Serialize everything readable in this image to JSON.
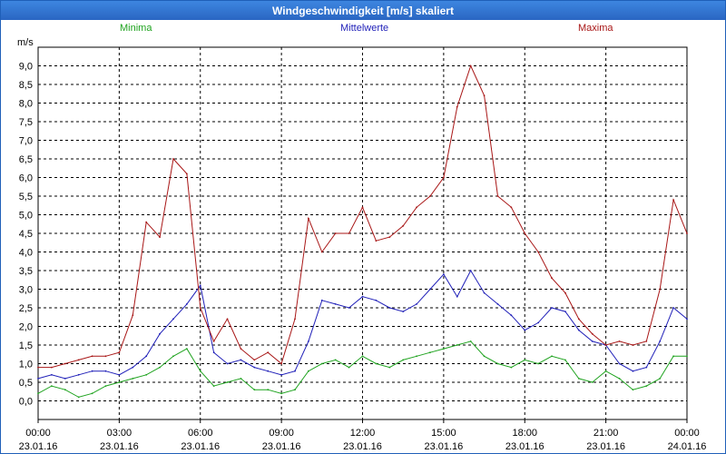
{
  "window": {
    "title": "Windgeschwindigkeit [m/s] skaliert"
  },
  "colors": {
    "minima": "#1fa31f",
    "mittelwerte": "#1f1fb8",
    "maxima": "#a81616",
    "title_bar": "#2f6fcf"
  },
  "chart_data": {
    "type": "line",
    "title": "Windgeschwindigkeit [m/s] skaliert",
    "ylabel": "m/s",
    "xlabel": "",
    "ylim": [
      -0.5,
      9.5
    ],
    "y_ticks": [
      "0,0",
      "0,5",
      "1,0",
      "1,5",
      "2,0",
      "2,5",
      "3,0",
      "3,5",
      "4,0",
      "4,5",
      "5,0",
      "5,5",
      "6,0",
      "6,5",
      "7,0",
      "7,5",
      "8,0",
      "8,5",
      "9,0"
    ],
    "x_ticks": [
      {
        "time": "00:00",
        "date": "23.01.16"
      },
      {
        "time": "03:00",
        "date": "23.01.16"
      },
      {
        "time": "06:00",
        "date": "23.01.16"
      },
      {
        "time": "09:00",
        "date": "23.01.16"
      },
      {
        "time": "12:00",
        "date": "23.01.16"
      },
      {
        "time": "15:00",
        "date": "23.01.16"
      },
      {
        "time": "18:00",
        "date": "23.01.16"
      },
      {
        "time": "21:00",
        "date": "23.01.16"
      },
      {
        "time": "00:00",
        "date": "24.01.16"
      }
    ],
    "xlim_hours": [
      0,
      24
    ],
    "grid": true,
    "legend_placement": "top",
    "series": [
      {
        "name": "Minima",
        "color": "#1fa31f",
        "x_hours": [
          0,
          0.5,
          1,
          1.5,
          2,
          2.5,
          3,
          3.5,
          4,
          4.5,
          5,
          5.5,
          6,
          6.5,
          7,
          7.5,
          8,
          8.5,
          9,
          9.5,
          10,
          10.5,
          11,
          11.5,
          12,
          12.5,
          13,
          13.5,
          14,
          14.5,
          15,
          15.5,
          16,
          16.5,
          17,
          17.5,
          18,
          18.5,
          19,
          19.5,
          20,
          20.5,
          21,
          21.5,
          22,
          22.5,
          23,
          23.5,
          24
        ],
        "values": [
          0.2,
          0.4,
          0.3,
          0.1,
          0.2,
          0.4,
          0.5,
          0.6,
          0.7,
          0.9,
          1.2,
          1.4,
          0.8,
          0.4,
          0.5,
          0.6,
          0.3,
          0.3,
          0.2,
          0.3,
          0.8,
          1.0,
          1.1,
          0.9,
          1.2,
          1.0,
          0.9,
          1.1,
          1.2,
          1.3,
          1.4,
          1.5,
          1.6,
          1.2,
          1.0,
          0.9,
          1.1,
          1.0,
          1.2,
          1.1,
          0.6,
          0.5,
          0.8,
          0.6,
          0.3,
          0.4,
          0.6,
          1.2,
          1.2
        ]
      },
      {
        "name": "Mittelwerte",
        "color": "#1f1fb8",
        "x_hours": [
          0,
          0.5,
          1,
          1.5,
          2,
          2.5,
          3,
          3.5,
          4,
          4.5,
          5,
          5.5,
          6,
          6.5,
          7,
          7.5,
          8,
          8.5,
          9,
          9.5,
          10,
          10.5,
          11,
          11.5,
          12,
          12.5,
          13,
          13.5,
          14,
          14.5,
          15,
          15.5,
          16,
          16.5,
          17,
          17.5,
          18,
          18.5,
          19,
          19.5,
          20,
          20.5,
          21,
          21.5,
          22,
          22.5,
          23,
          23.5,
          24
        ],
        "values": [
          0.6,
          0.7,
          0.6,
          0.7,
          0.8,
          0.8,
          0.7,
          0.9,
          1.2,
          1.8,
          2.2,
          2.6,
          3.1,
          1.3,
          1.0,
          1.1,
          0.9,
          0.8,
          0.7,
          0.8,
          1.6,
          2.7,
          2.6,
          2.5,
          2.8,
          2.7,
          2.5,
          2.4,
          2.6,
          3.0,
          3.4,
          2.8,
          3.5,
          2.9,
          2.6,
          2.3,
          1.9,
          2.1,
          2.5,
          2.4,
          1.9,
          1.6,
          1.5,
          1.0,
          0.8,
          0.9,
          1.6,
          2.5,
          2.2
        ]
      },
      {
        "name": "Maxima",
        "color": "#a81616",
        "x_hours": [
          0,
          0.5,
          1,
          1.5,
          2,
          2.5,
          3,
          3.5,
          4,
          4.5,
          5,
          5.5,
          6,
          6.5,
          7,
          7.5,
          8,
          8.5,
          9,
          9.5,
          10,
          10.5,
          11,
          11.5,
          12,
          12.5,
          13,
          13.5,
          14,
          14.5,
          15,
          15.5,
          16,
          16.5,
          17,
          17.5,
          18,
          18.5,
          19,
          19.5,
          20,
          20.5,
          21,
          21.5,
          22,
          22.5,
          23,
          23.5,
          24
        ],
        "values": [
          0.9,
          0.9,
          1.0,
          1.1,
          1.2,
          1.2,
          1.3,
          2.3,
          4.8,
          4.4,
          6.5,
          6.1,
          2.5,
          1.6,
          2.2,
          1.4,
          1.1,
          1.3,
          1.0,
          2.2,
          4.9,
          4.0,
          4.5,
          4.5,
          5.2,
          4.3,
          4.4,
          4.7,
          5.2,
          5.5,
          6.0,
          7.9,
          9.0,
          8.2,
          5.5,
          5.2,
          4.5,
          4.0,
          3.3,
          2.9,
          2.2,
          1.8,
          1.5,
          1.6,
          1.5,
          1.6,
          3.0,
          5.4,
          4.5
        ]
      }
    ]
  }
}
